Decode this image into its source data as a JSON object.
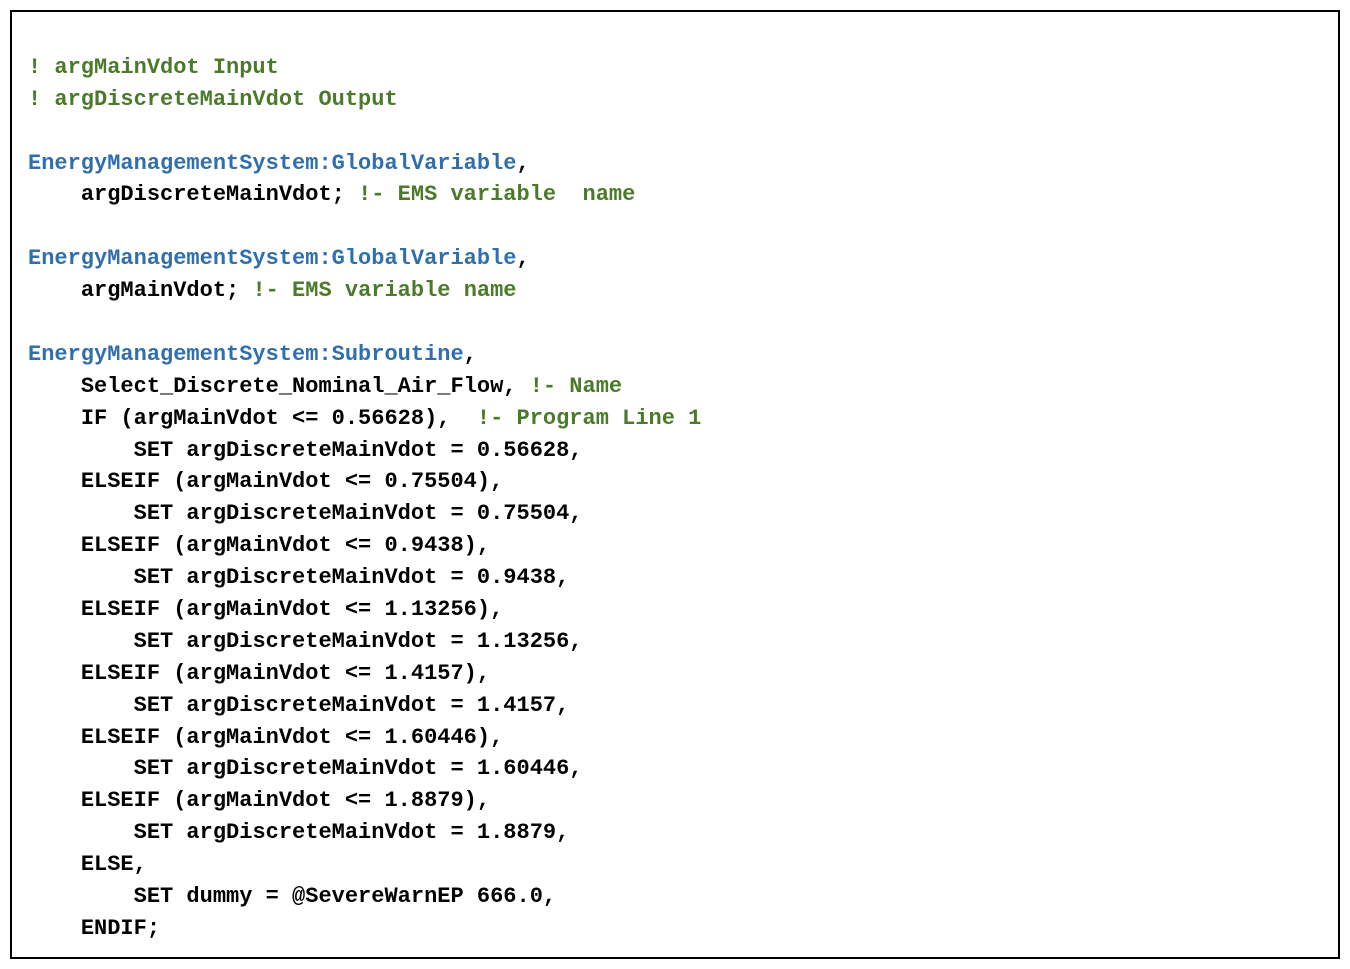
{
  "code": {
    "c1": "! argMainVdot Input",
    "c2": "! argDiscreteMainVdot Output",
    "gv1_head": "EnergyManagementSystem:GlobalVariable",
    "comma": ",",
    "indent": "    ",
    "gv1_name": "argDiscreteMainVdot; ",
    "gv1_cm": "!- EMS variable  name",
    "gv2_head": "EnergyManagementSystem:GlobalVariable",
    "gv2_name": "argMainVdot; ",
    "gv2_cm": "!- EMS variable name",
    "sub_head": "EnergyManagementSystem:Subroutine",
    "sub_name": "Select_Discrete_Nominal_Air_Flow, ",
    "sub_name_cm": "!- Name",
    "if1": "IF (argMainVdot <= 0.56628),  ",
    "if1_cm": "!- Program Line 1",
    "set_indent": "        ",
    "set1": "SET argDiscreteMainVdot = 0.56628,",
    "elif2": "ELSEIF (argMainVdot <= 0.75504),",
    "set2": "SET argDiscreteMainVdot = 0.75504,",
    "elif3": "ELSEIF (argMainVdot <= 0.9438),",
    "set3": "SET argDiscreteMainVdot = 0.9438,",
    "elif4": "ELSEIF (argMainVdot <= 1.13256),",
    "set4": "SET argDiscreteMainVdot = 1.13256,",
    "elif5": "ELSEIF (argMainVdot <= 1.4157),",
    "set5": "SET argDiscreteMainVdot = 1.4157,",
    "elif6": "ELSEIF (argMainVdot <= 1.60446),",
    "set6": "SET argDiscreteMainVdot = 1.60446,",
    "elif7": "ELSEIF (argMainVdot <= 1.8879),",
    "set7": "SET argDiscreteMainVdot = 1.8879,",
    "else": "ELSE,",
    "set8": "SET dummy = @SevereWarnEP 666.0,",
    "endif": "ENDIF;"
  }
}
